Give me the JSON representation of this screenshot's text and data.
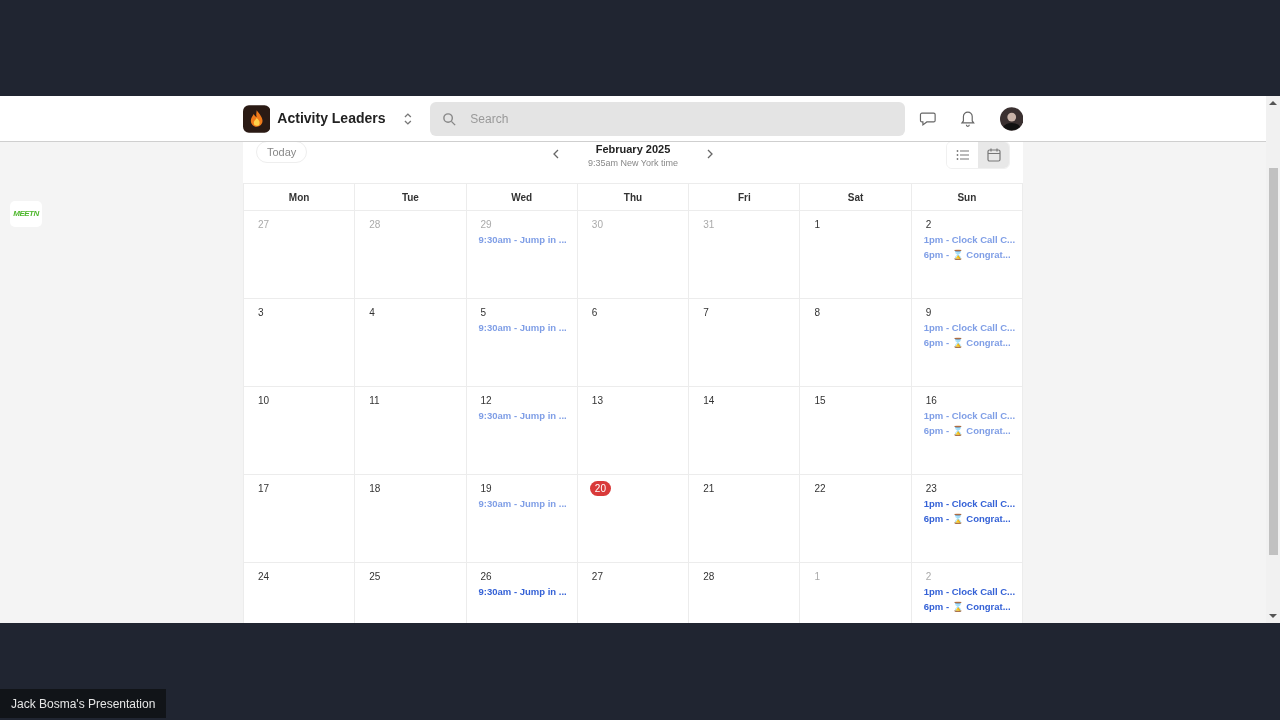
{
  "header": {
    "workspace": "Activity Leaders",
    "search": {
      "placeholder": "Search"
    }
  },
  "sidebar": {
    "app_badge": "MEETN"
  },
  "toolbar": {
    "today": "Today",
    "month": "February 2025",
    "local_time": "9:35am New York time",
    "views": [
      {
        "kind": "list",
        "selected": false
      },
      {
        "kind": "calendar",
        "selected": true
      }
    ]
  },
  "weekdays": [
    "Mon",
    "Tue",
    "Wed",
    "Thu",
    "Fri",
    "Sat",
    "Sun"
  ],
  "weeks": [
    [
      {
        "day": "27",
        "other_month": true,
        "today": false
      },
      {
        "day": "28",
        "other_month": true,
        "today": false
      },
      {
        "day": "29",
        "other_month": true,
        "today": false,
        "events": [
          {
            "text": "9:30am - Jump in ...",
            "past": true
          }
        ]
      },
      {
        "day": "30",
        "other_month": true,
        "today": false
      },
      {
        "day": "31",
        "other_month": true,
        "today": false
      },
      {
        "day": "1",
        "other_month": false,
        "today": false
      },
      {
        "day": "2",
        "other_month": false,
        "today": false,
        "events": [
          {
            "text": "1pm - Clock Call C...",
            "past": true
          },
          {
            "text": "6pm - ⌛ Congrat...",
            "past": true
          }
        ]
      }
    ],
    [
      {
        "day": "3",
        "other_month": false,
        "today": false
      },
      {
        "day": "4",
        "other_month": false,
        "today": false
      },
      {
        "day": "5",
        "other_month": false,
        "today": false,
        "events": [
          {
            "text": "9:30am - Jump in ...",
            "past": true
          }
        ]
      },
      {
        "day": "6",
        "other_month": false,
        "today": false
      },
      {
        "day": "7",
        "other_month": false,
        "today": false
      },
      {
        "day": "8",
        "other_month": false,
        "today": false
      },
      {
        "day": "9",
        "other_month": false,
        "today": false,
        "events": [
          {
            "text": "1pm - Clock Call C...",
            "past": true
          },
          {
            "text": "6pm - ⌛ Congrat...",
            "past": true
          }
        ]
      }
    ],
    [
      {
        "day": "10",
        "other_month": false,
        "today": false
      },
      {
        "day": "11",
        "other_month": false,
        "today": false
      },
      {
        "day": "12",
        "other_month": false,
        "today": false,
        "events": [
          {
            "text": "9:30am - Jump in ...",
            "past": true
          }
        ]
      },
      {
        "day": "13",
        "other_month": false,
        "today": false
      },
      {
        "day": "14",
        "other_month": false,
        "today": false
      },
      {
        "day": "15",
        "other_month": false,
        "today": false
      },
      {
        "day": "16",
        "other_month": false,
        "today": false,
        "events": [
          {
            "text": "1pm - Clock Call C...",
            "past": true
          },
          {
            "text": "6pm - ⌛ Congrat...",
            "past": true
          }
        ]
      }
    ],
    [
      {
        "day": "17",
        "other_month": false,
        "today": false
      },
      {
        "day": "18",
        "other_month": false,
        "today": false
      },
      {
        "day": "19",
        "other_month": false,
        "today": false,
        "events": [
          {
            "text": "9:30am - Jump in ...",
            "past": true
          }
        ]
      },
      {
        "day": "20",
        "other_month": false,
        "today": true
      },
      {
        "day": "21",
        "other_month": false,
        "today": false
      },
      {
        "day": "22",
        "other_month": false,
        "today": false
      },
      {
        "day": "23",
        "other_month": false,
        "today": false,
        "events": [
          {
            "text": "1pm - Clock Call C...",
            "past": false
          },
          {
            "text": "6pm - ⌛ Congrat...",
            "past": false
          }
        ]
      }
    ],
    [
      {
        "day": "24",
        "other_month": false,
        "today": false
      },
      {
        "day": "25",
        "other_month": false,
        "today": false
      },
      {
        "day": "26",
        "other_month": false,
        "today": false,
        "events": [
          {
            "text": "9:30am - Jump in ...",
            "past": false
          }
        ]
      },
      {
        "day": "27",
        "other_month": false,
        "today": false
      },
      {
        "day": "28",
        "other_month": false,
        "today": false
      },
      {
        "day": "1",
        "other_month": true,
        "today": false
      },
      {
        "day": "2",
        "other_month": true,
        "today": false,
        "events": [
          {
            "text": "1pm - Clock Call C...",
            "past": false
          },
          {
            "text": "6pm - ⌛ Congrat...",
            "past": false
          }
        ]
      }
    ]
  ],
  "presenter_label": "Jack Bosma's Presentation"
}
